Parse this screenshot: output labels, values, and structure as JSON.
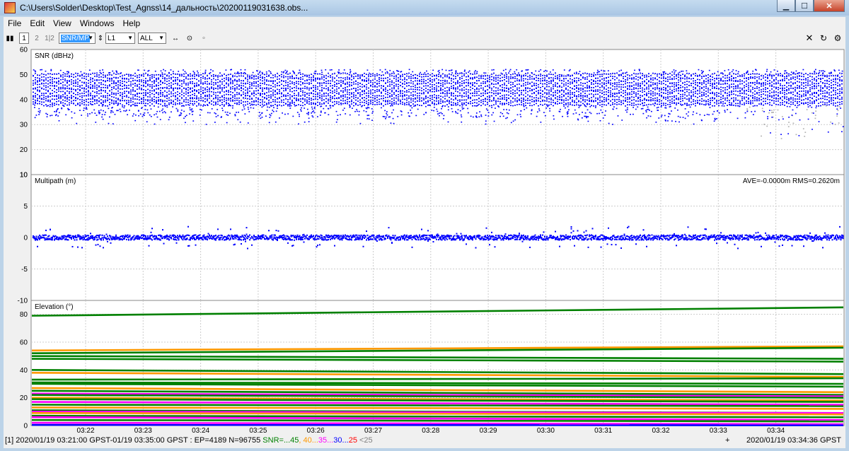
{
  "window": {
    "title": "C:\\Users\\Solder\\Desktop\\Test_Agnss\\14_дальность\\20200119031638.obs..."
  },
  "menu": [
    "File",
    "Edit",
    "View",
    "Windows",
    "Help"
  ],
  "toolbar": {
    "frame1": "1",
    "frame2": "2",
    "frame12": "1|2",
    "plot_type": "SNR/MP",
    "freq": "L1",
    "sat": "ALL"
  },
  "colors": {
    "snr_dots": "#0000ff",
    "snr_gray": "#b0b0b0",
    "elev_green": "#008000",
    "elev_orange": "#ff9900",
    "elev_magenta": "#ff00ff",
    "elev_blue": "#0000ff",
    "elev_red": "#ff0000"
  },
  "chart_data": [
    {
      "type": "scatter",
      "title": "SNR (dBHz)",
      "ylim": [
        10,
        60
      ],
      "yticks": [
        "60",
        "50",
        "40",
        "30",
        "20",
        "10"
      ],
      "x": [
        "03:22",
        "03:23",
        "03:24",
        "03:25",
        "03:26",
        "03:27",
        "03:28",
        "03:29",
        "03:30",
        "03:31",
        "03:32",
        "03:33",
        "03:34"
      ],
      "series": [
        {
          "name": "",
          "values_summary": {
            "min": 22,
            "max": 52,
            "main_band": [
              32,
              50
            ]
          }
        }
      ],
      "grid": true
    },
    {
      "type": "scatter",
      "title": "Multipath (m)",
      "annotation": "AVE=-0.0000m RMS=0.2620m",
      "ylim": [
        -10,
        10
      ],
      "yticks": [
        "10",
        "5",
        "0",
        "-5",
        "-10"
      ],
      "x": [
        "03:22",
        "03:23",
        "03:24",
        "03:25",
        "03:26",
        "03:27",
        "03:28",
        "03:29",
        "03:30",
        "03:31",
        "03:32",
        "03:33",
        "03:34"
      ],
      "series": [
        {
          "name": "",
          "values_summary": {
            "mean": 0,
            "min": -2.5,
            "max": 3.8
          }
        }
      ],
      "grid": true
    },
    {
      "type": "line",
      "title": "Elevation (°)",
      "ylim": [
        0,
        90
      ],
      "yticks": [
        "80",
        "60",
        "40",
        "20",
        "0"
      ],
      "x": [
        "03:22",
        "03:23",
        "03:24",
        "03:25",
        "03:26",
        "03:27",
        "03:28",
        "03:29",
        "03:30",
        "03:31",
        "03:32",
        "03:33",
        "03:34"
      ],
      "series": [
        {
          "start": 79,
          "end": 85,
          "color": "green"
        },
        {
          "start": 54,
          "end": 57,
          "color": "orange"
        },
        {
          "start": 52,
          "end": 56,
          "color": "green"
        },
        {
          "start": 50,
          "end": 48,
          "color": "green"
        },
        {
          "start": 48,
          "end": 46,
          "color": "green"
        },
        {
          "start": 40,
          "end": 37,
          "color": "green"
        },
        {
          "start": 38,
          "end": 35,
          "color": "orange"
        },
        {
          "start": 33,
          "end": 34,
          "color": "green"
        },
        {
          "start": 31,
          "end": 30,
          "color": "green"
        },
        {
          "start": 30,
          "end": 28,
          "color": "green"
        },
        {
          "start": 27,
          "end": 24,
          "color": "orange"
        },
        {
          "start": 25,
          "end": 22,
          "color": "green"
        },
        {
          "start": 23,
          "end": 21,
          "color": "magenta"
        },
        {
          "start": 22,
          "end": 20,
          "color": "green"
        },
        {
          "start": 20,
          "end": 18,
          "color": "orange"
        },
        {
          "start": 19,
          "end": 17,
          "color": "green"
        },
        {
          "start": 17,
          "end": 15,
          "color": "magenta"
        },
        {
          "start": 15,
          "end": 14,
          "color": "green"
        },
        {
          "start": 13,
          "end": 12,
          "color": "orange"
        },
        {
          "start": 11,
          "end": 9,
          "color": "green"
        },
        {
          "start": 10,
          "end": 9,
          "color": "magenta"
        },
        {
          "start": 9,
          "end": 8,
          "color": "orange"
        },
        {
          "start": 7,
          "end": 6,
          "color": "green"
        },
        {
          "start": 6,
          "end": 4,
          "color": "magenta"
        },
        {
          "start": 4,
          "end": 3,
          "color": "green"
        },
        {
          "start": 2,
          "end": 1,
          "color": "magenta"
        },
        {
          "start": 0.5,
          "end": 0.2,
          "color": "blue"
        }
      ],
      "grid": true
    }
  ],
  "status": {
    "left": "[1] 2020/01/19 03:21:00 GPST-01/19 03:35:00 GPST : EP=4189 N=96755",
    "snr_prefix": "SNR=",
    "snr_bins": [
      {
        "label": "...45",
        "color": "#008000"
      },
      {
        "label": ", 40...",
        "color": "#ff9900"
      },
      {
        "label": "35...",
        "color": "#ff00ff"
      },
      {
        "label": "30...",
        "color": "#0000ff"
      },
      {
        "label": "25",
        "color": "#ff0000"
      },
      {
        "label": " <25",
        "color": "#808080"
      }
    ],
    "cursor": "+",
    "right": "2020/01/19 03:34:36 GPST"
  }
}
